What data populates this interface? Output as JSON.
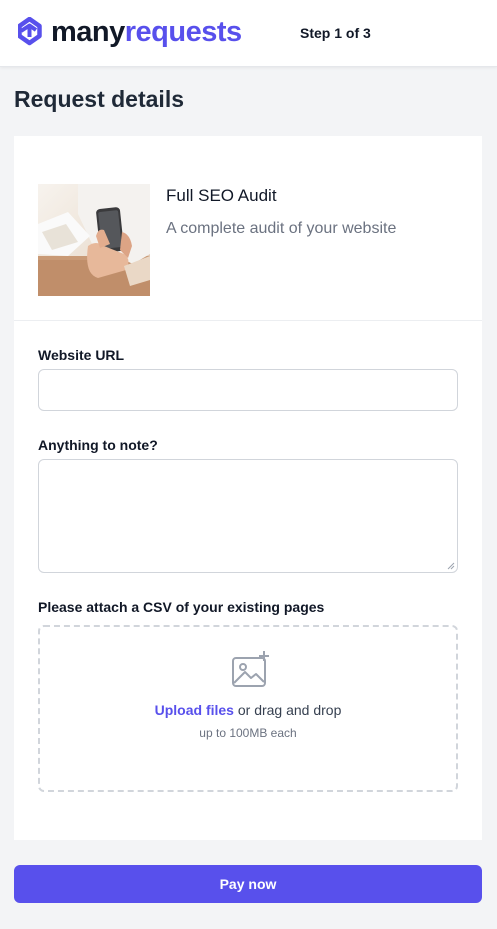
{
  "header": {
    "logo_word1": "many",
    "logo_word2": "requests",
    "step": "Step 1 of 3"
  },
  "page_title": "Request details",
  "product": {
    "name": "Full SEO Audit",
    "description": "A complete audit of your website",
    "image": "person-holding-phone-photo"
  },
  "form": {
    "website_url": {
      "label": "Website URL",
      "value": "",
      "placeholder": ""
    },
    "notes": {
      "label": "Anything to note?",
      "value": "",
      "placeholder": ""
    },
    "attachment": {
      "label": "Please attach a CSV of your existing pages",
      "upload_link": "Upload files",
      "upload_text": " or drag and drop",
      "hint": "up to 100MB each",
      "icon": "image-add-icon"
    }
  },
  "pay_button": "Pay now",
  "colors": {
    "accent": "#5850ec",
    "page_background": "#f3f4f6",
    "text_dark": "#111827",
    "text_muted": "#6b7280"
  }
}
